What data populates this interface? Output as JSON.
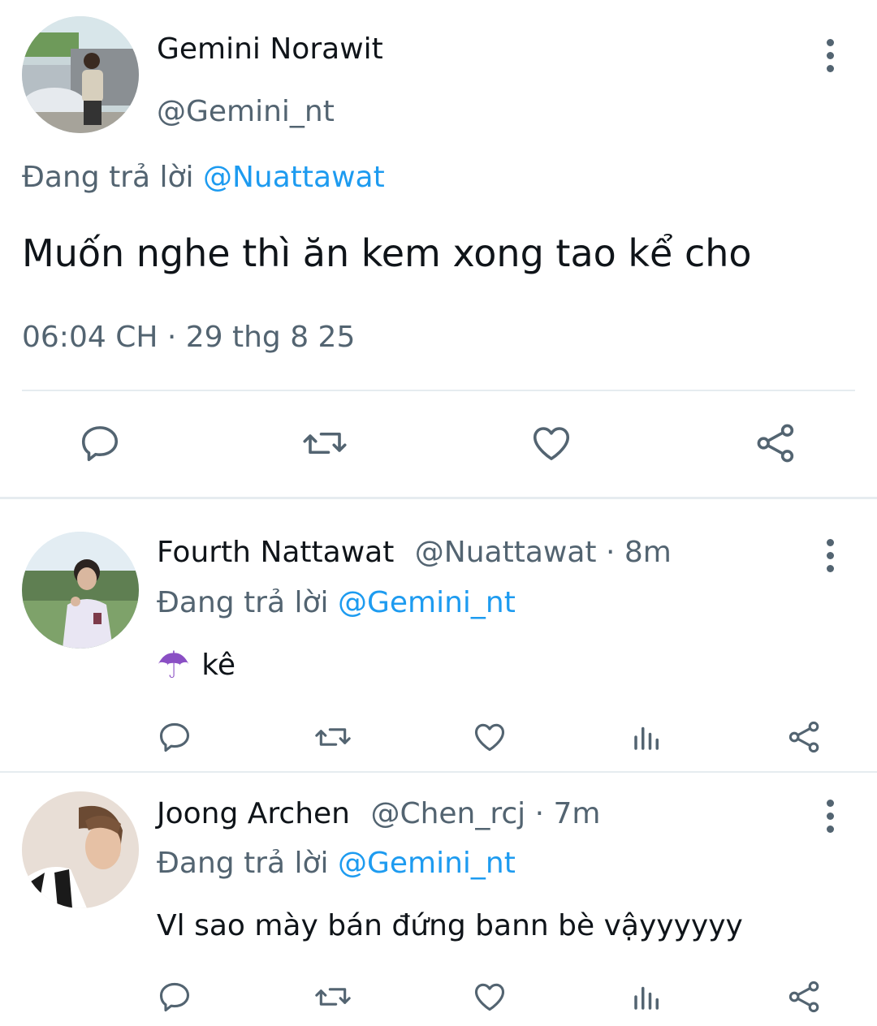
{
  "main_tweet": {
    "author_name": "Gemini Norawit",
    "author_handle": "@Gemini_nt",
    "reply_prefix": "Đang trả lời",
    "reply_to": "@Nuattawat",
    "text": "Muốn nghe thì ăn kem xong tao kể cho",
    "timestamp": "06:04 CH · 29 thg 8 25",
    "actions": [
      "reply-icon",
      "retweet-icon",
      "like-icon",
      "share-icon"
    ]
  },
  "replies": [
    {
      "author_name": "Fourth Nattawat",
      "author_handle": "@Nuattawat",
      "time": "· 8m",
      "reply_prefix": "Đang trả lời",
      "reply_to": "@Gemini_nt",
      "emoji": "☂",
      "text": "kê",
      "actions": [
        "reply-icon",
        "retweet-icon",
        "like-icon",
        "views-icon",
        "share-icon"
      ]
    },
    {
      "author_name": "Joong Archen",
      "author_handle": "@Chen_rcj",
      "time": "· 7m",
      "reply_prefix": "Đang trả lời",
      "reply_to": "@Gemini_nt",
      "text": "Vl sao mày bán đứng bann bè vậyyyyyy",
      "actions": [
        "reply-icon",
        "retweet-icon",
        "like-icon",
        "views-icon",
        "share-icon"
      ]
    }
  ],
  "colors": {
    "link": "#1d9bf0",
    "muted": "#536471",
    "text": "#0f1419",
    "divider": "#e6ecf0"
  }
}
